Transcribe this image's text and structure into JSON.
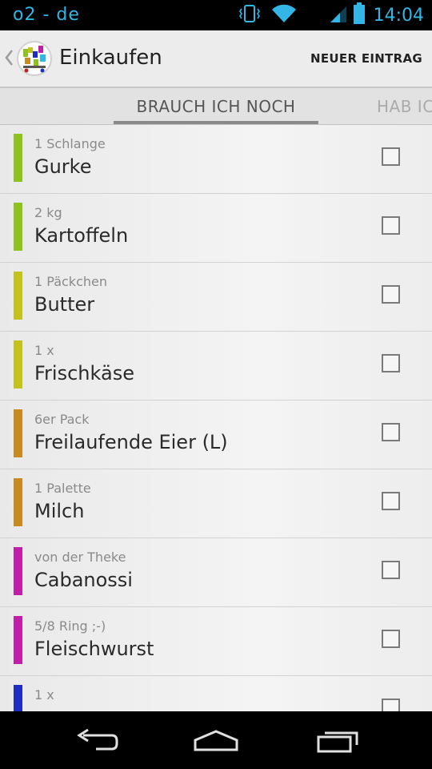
{
  "status_bar": {
    "carrier": "o2 - de",
    "time": "14:04",
    "icons": [
      "vibrate-icon",
      "wifi-icon",
      "signal-icon",
      "battery-icon"
    ],
    "accent_color": "#33b5e5"
  },
  "action_bar": {
    "title": "Einkaufen",
    "new_entry_label": "NEUER EINTRAG"
  },
  "tabs": {
    "active": "BRAUCH ICH NOCH",
    "next": "HAB IC"
  },
  "items": [
    {
      "qty": "1 Schlange",
      "name": "Gurke",
      "color": "#8dc21f",
      "checked": false
    },
    {
      "qty": "2 kg",
      "name": "Kartoffeln",
      "color": "#8dc21f",
      "checked": false
    },
    {
      "qty": "1 Päckchen",
      "name": "Butter",
      "color": "#c4c21c",
      "checked": false
    },
    {
      "qty": "1 x",
      "name": "Frischkäse",
      "color": "#c4c21c",
      "checked": false
    },
    {
      "qty": "6er Pack",
      "name": "Freilaufende Eier (L)",
      "color": "#c88a22",
      "checked": false
    },
    {
      "qty": "1 Palette",
      "name": "Milch",
      "color": "#c88a22",
      "checked": false
    },
    {
      "qty": "von der Theke",
      "name": "Cabanossi",
      "color": "#c21fa8",
      "checked": false
    },
    {
      "qty": "5/8 Ring ;-)",
      "name": "Fleischwurst",
      "color": "#c21fa8",
      "checked": false
    },
    {
      "qty": "1 x",
      "name": "",
      "color": "#1f2ec2",
      "checked": false
    }
  ],
  "nav_bar": {
    "icons": [
      "back-icon",
      "home-icon",
      "recents-icon"
    ]
  }
}
